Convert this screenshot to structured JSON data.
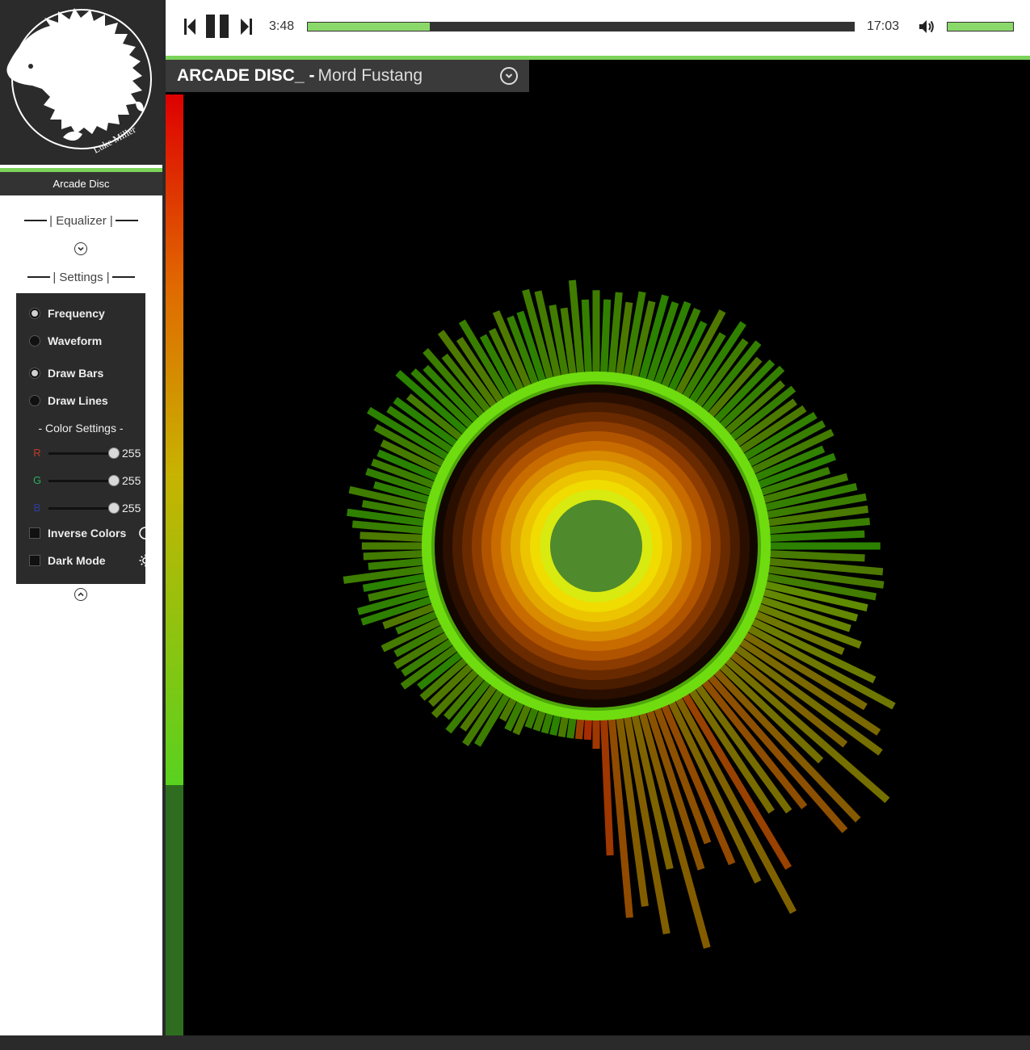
{
  "sidebar": {
    "logo_name": "Luke Miller",
    "playlist": [
      {
        "label": "Arcade Disc",
        "active": true
      }
    ],
    "equalizer": {
      "title": "| Equalizer |",
      "expand_icon": "chevron-down-circle-icon"
    },
    "settings": {
      "title": "| Settings |",
      "collapse_icon": "chevron-up-circle-icon",
      "mode_options": [
        {
          "label": "Frequency",
          "selected": true
        },
        {
          "label": "Waveform",
          "selected": false
        }
      ],
      "draw_options": [
        {
          "label": "Draw Bars",
          "selected": true
        },
        {
          "label": "Draw Lines",
          "selected": false
        }
      ],
      "color_settings_title": "- Color Settings -",
      "sliders": [
        {
          "label": "R",
          "value": "255",
          "color": "#c0392b"
        },
        {
          "label": "G",
          "value": "255",
          "color": "#27ae60"
        },
        {
          "label": "B",
          "value": "255",
          "color": "#2c3e9f"
        }
      ],
      "toggles": [
        {
          "label": "Inverse Colors",
          "checked": false,
          "icon": "contrast-icon"
        },
        {
          "label": "Dark Mode",
          "checked": false,
          "icon": "sun-icon"
        }
      ]
    }
  },
  "player": {
    "current_time": "3:48",
    "total_time": "17:03",
    "progress_fraction": 0.223,
    "volume_fraction": 1.0,
    "icons": [
      "previous-icon",
      "pause-icon",
      "next-icon",
      "volume-icon"
    ]
  },
  "now_playing": {
    "artist": "ARCADE DISC_",
    "separator": "-",
    "title": "Mord Fustang"
  },
  "theme": {
    "accent": "#7bd35a",
    "panel": "#2b2b2b",
    "stage": "#000000"
  }
}
